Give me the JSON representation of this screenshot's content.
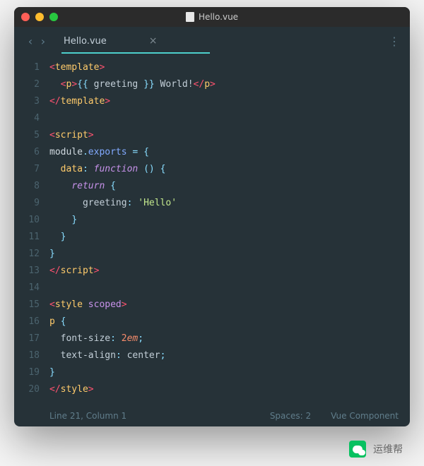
{
  "titlebar": {
    "filename": "Hello.vue"
  },
  "tab": {
    "name": "Hello.vue"
  },
  "gutter": [
    "1",
    "2",
    "3",
    "4",
    "5",
    "6",
    "7",
    "8",
    "9",
    "10",
    "11",
    "12",
    "13",
    "14",
    "15",
    "16",
    "17",
    "18",
    "19",
    "20"
  ],
  "code": {
    "l1": {
      "open": "<",
      "tag": "template",
      "close": ">"
    },
    "l2": {
      "open1": "<",
      "tag1": "p",
      "close1": ">",
      "expr_open": "{{ ",
      "expr": "greeting",
      "expr_close": " }}",
      "text": " World!",
      "open2": "</",
      "tag2": "p",
      "close2": ">"
    },
    "l3": {
      "open": "</",
      "tag": "template",
      "close": ">"
    },
    "l5": {
      "open": "<",
      "tag": "script",
      "close": ">"
    },
    "l6": {
      "obj": "module",
      "dot": ".",
      "prop": "exports",
      "eq": " = ",
      "brace": "{"
    },
    "l7": {
      "key": "data",
      "colon": ": ",
      "fn": "function ",
      "paren": "()",
      "sp": " ",
      "brace": "{"
    },
    "l8": {
      "ret": "return ",
      "brace": "{"
    },
    "l9": {
      "key": "greeting",
      "colon": ": ",
      "str": "'Hello'"
    },
    "l10": {
      "brace": "}"
    },
    "l11": {
      "brace": "}"
    },
    "l12": {
      "brace": "}"
    },
    "l13": {
      "open": "</",
      "tag": "script",
      "close": ">"
    },
    "l15": {
      "open": "<",
      "tag": "style",
      "sp": " ",
      "attr": "scoped",
      "close": ">"
    },
    "l16": {
      "sel": "p",
      "sp": " ",
      "brace": "{"
    },
    "l17": {
      "prop": "font-size",
      "colon": ": ",
      "num": "2",
      "unit": "em",
      "semi": ";"
    },
    "l18": {
      "prop": "text-align",
      "colon": ": ",
      "val": "center",
      "semi": ";"
    },
    "l19": {
      "brace": "}"
    },
    "l20": {
      "open": "</",
      "tag": "style",
      "close": ">"
    }
  },
  "status": {
    "left": "Line 21, Column 1",
    "spaces": "Spaces: 2",
    "syntax": "Vue Component"
  },
  "footer": {
    "text": "运维帮"
  }
}
